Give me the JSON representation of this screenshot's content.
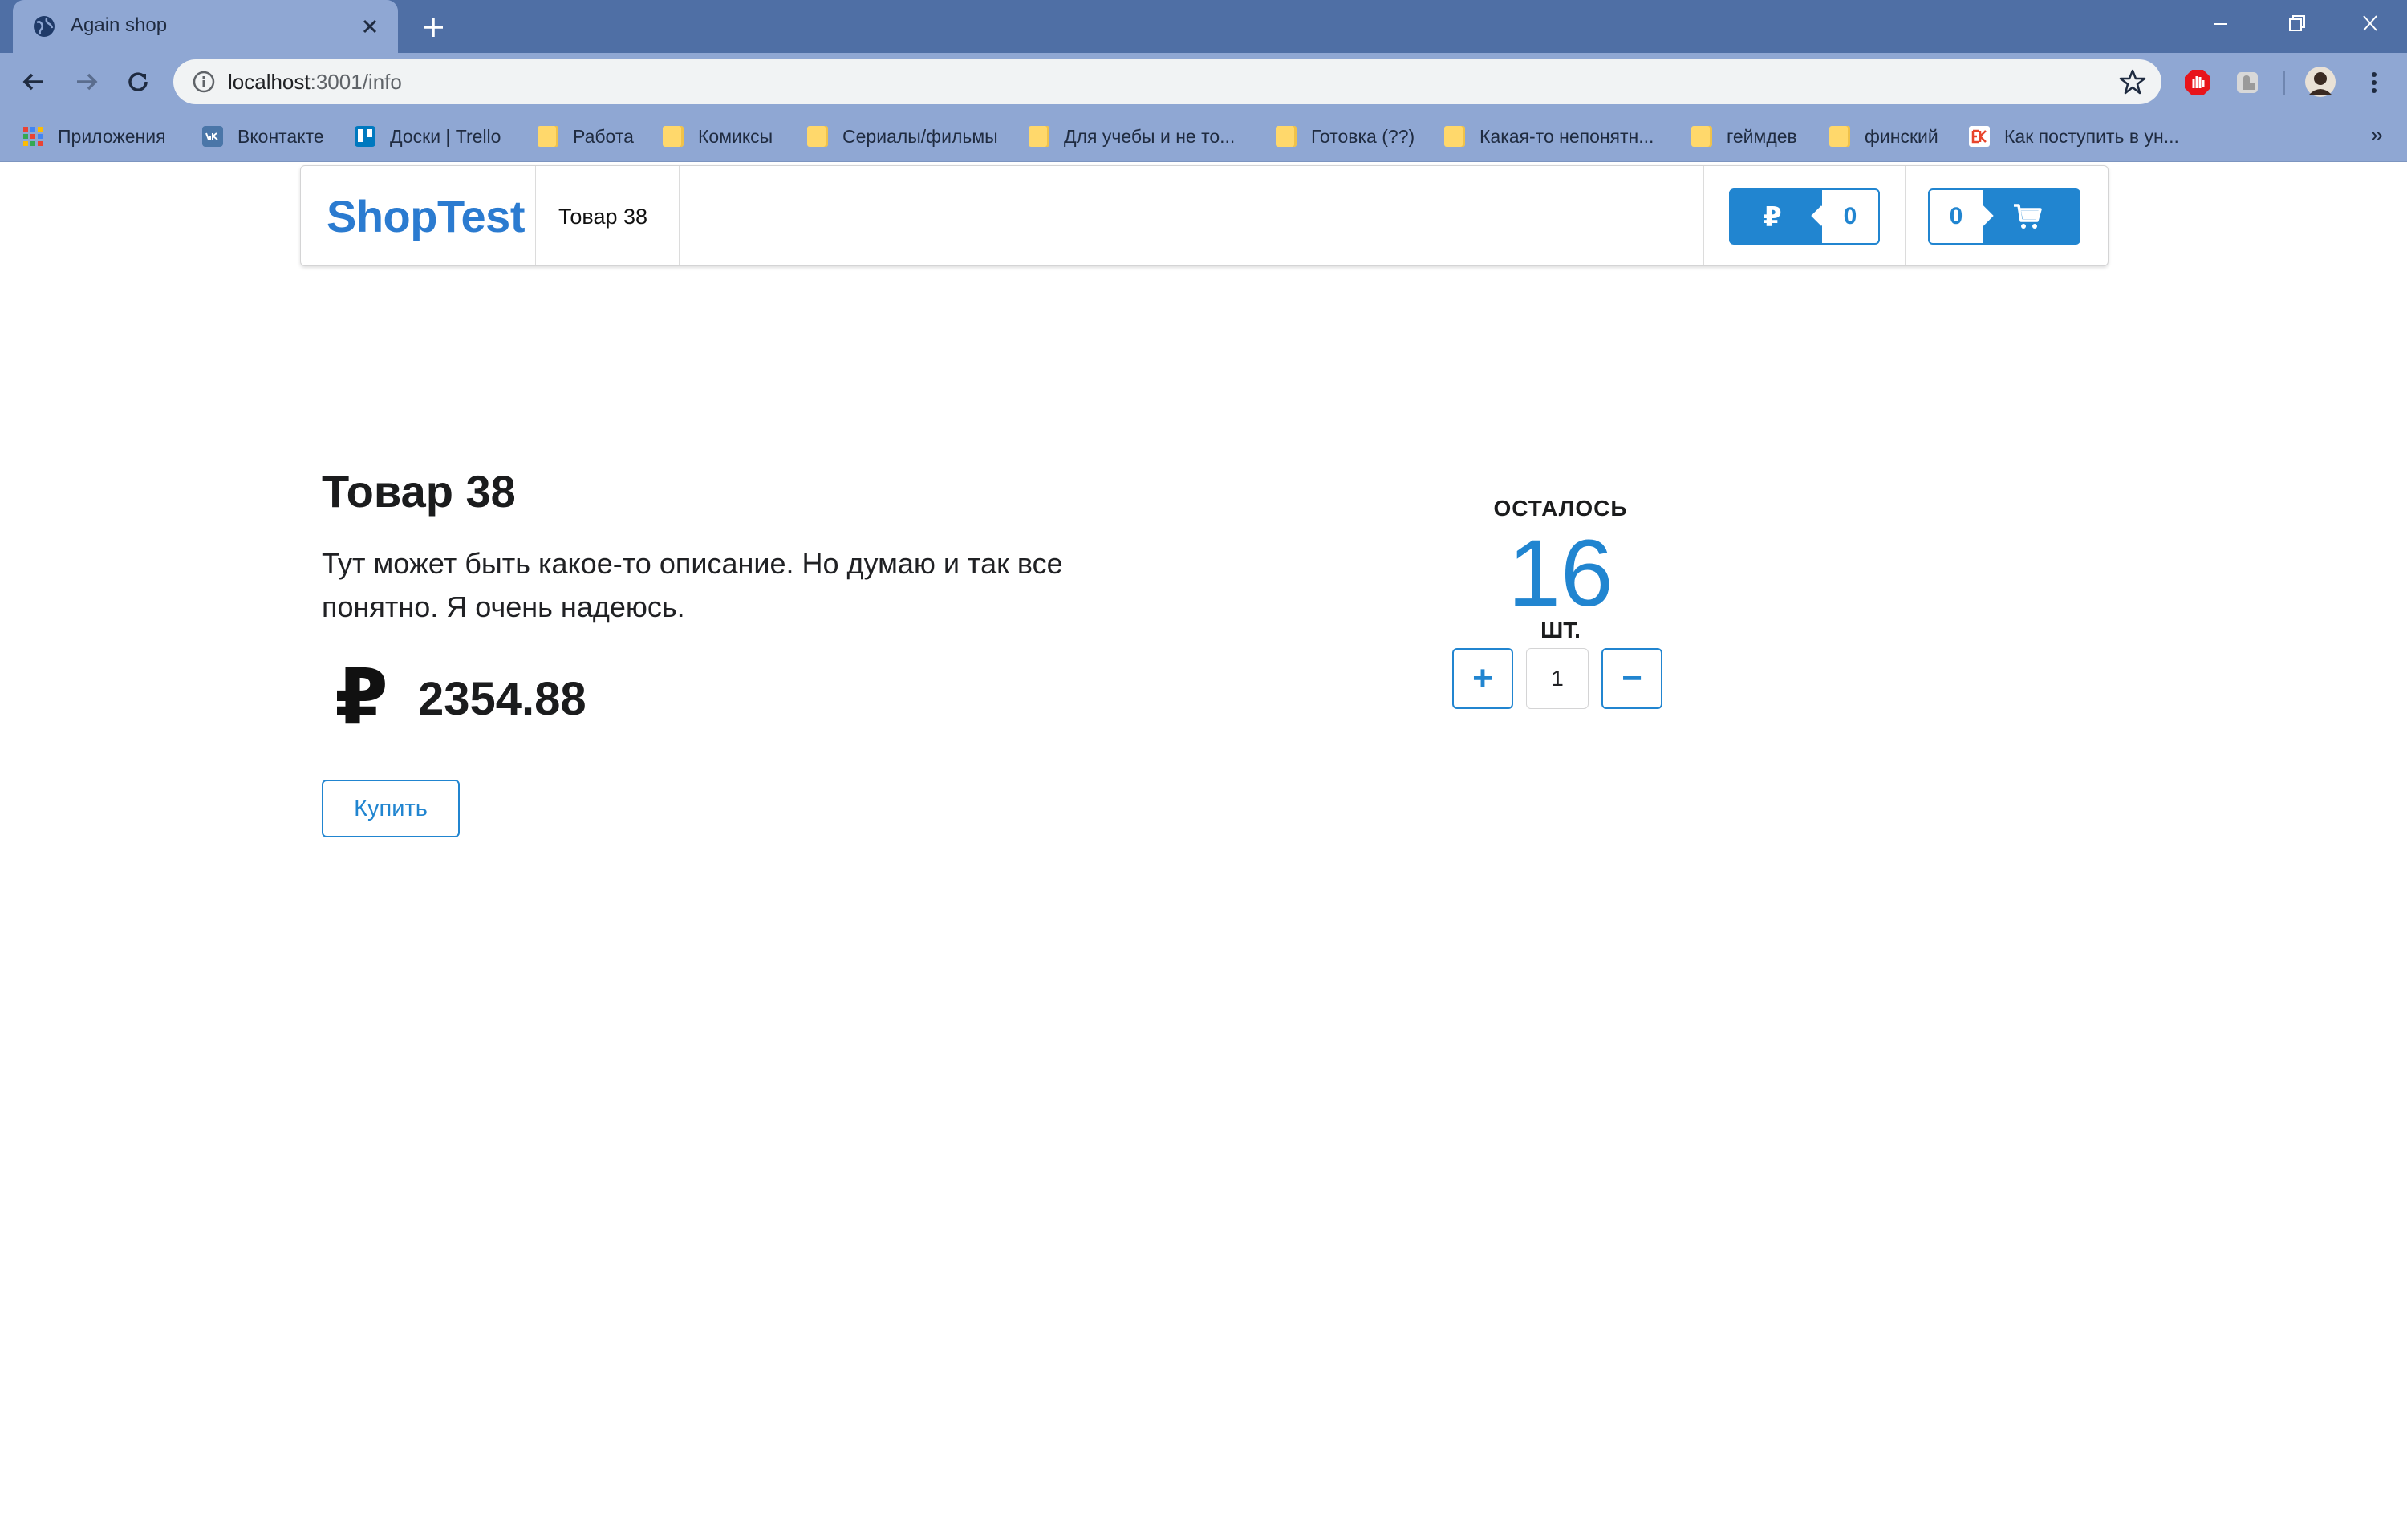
{
  "browser": {
    "tab_title": "Again shop",
    "url_host": "localhost",
    "url_path": ":3001/info",
    "bookmarks": [
      {
        "label": "Приложения",
        "icon": "apps-grid-icon"
      },
      {
        "label": "Вконтакте",
        "icon": "vk-icon"
      },
      {
        "label": "Доски | Trello",
        "icon": "trello-icon"
      },
      {
        "label": "Работа",
        "icon": "folder-icon"
      },
      {
        "label": "Комиксы",
        "icon": "folder-icon"
      },
      {
        "label": "Сериалы/фильмы",
        "icon": "folder-icon"
      },
      {
        "label": "Для учебы и не то...",
        "icon": "folder-icon"
      },
      {
        "label": "Готовка (??)",
        "icon": "folder-icon"
      },
      {
        "label": "Какая-то непонятн...",
        "icon": "folder-icon"
      },
      {
        "label": "геймдев",
        "icon": "folder-icon"
      },
      {
        "label": "финский",
        "icon": "folder-icon"
      },
      {
        "label": "Как поступить в ун...",
        "icon": "ek-icon"
      }
    ],
    "bookmarks_more": "»"
  },
  "header": {
    "brand": "ShopTest",
    "nav_item": "Товар 38",
    "balance_symbol": "₽",
    "balance_count": "0",
    "cart_count": "0"
  },
  "product": {
    "title": "Товар 38",
    "description": "Тут может быть какое-то описание. Но думаю и так все понятно. Я очень надеюсь.",
    "currency_symbol": "₽",
    "price": "2354.88",
    "buy_label": "Купить"
  },
  "stock": {
    "label": "ОСТАЛОСЬ",
    "value": "16",
    "unit": "ШТ."
  },
  "quantity": {
    "plus": "+",
    "minus": "−",
    "value": "1"
  },
  "colors": {
    "accent": "#2185d0",
    "chrome": "#4f6fa5",
    "chrome_light": "#8fa7d3"
  }
}
